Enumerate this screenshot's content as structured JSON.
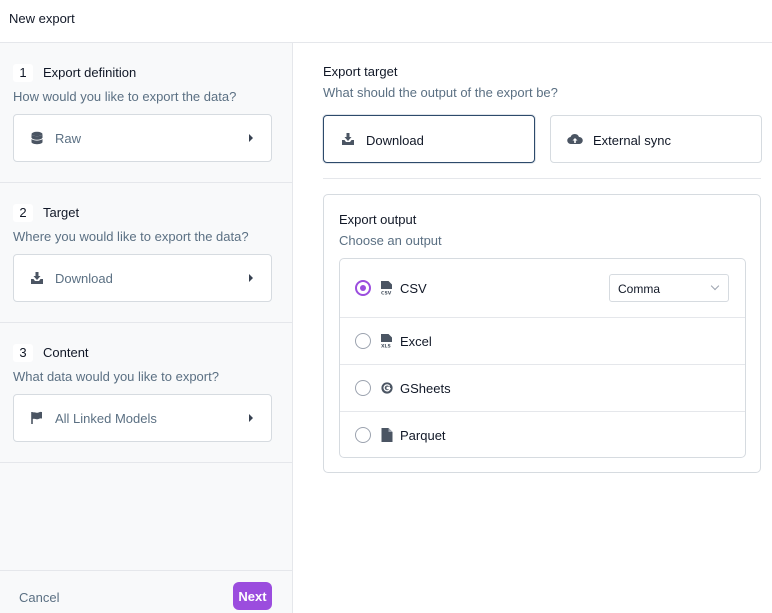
{
  "window": {
    "title": "New export"
  },
  "steps": [
    {
      "number": "1",
      "label": "Export definition",
      "question": "How would you like to export the data?",
      "value": "Raw",
      "icon": "database-icon"
    },
    {
      "number": "2",
      "label": "Target",
      "question": "Where you would like to export the data?",
      "value": "Download",
      "icon": "download-icon"
    },
    {
      "number": "3",
      "label": "Content",
      "question": "What data would you like to export?",
      "value": "All Linked Models",
      "icon": "flag-icon"
    }
  ],
  "footer": {
    "cancel_label": "Cancel",
    "next_label": "Next"
  },
  "target": {
    "heading": "Export target",
    "subheading": "What should the output of the export be?",
    "options": [
      {
        "label": "Download",
        "icon": "download-icon",
        "selected": true
      },
      {
        "label": "External sync",
        "icon": "cloud-upload-icon",
        "selected": false
      }
    ]
  },
  "output": {
    "heading": "Export output",
    "subheading": "Choose an output",
    "options": [
      {
        "label": "CSV",
        "icon": "csv-file-icon",
        "selected": true,
        "delimiter": "Comma"
      },
      {
        "label": "Excel",
        "icon": "xls-file-icon",
        "selected": false
      },
      {
        "label": "GSheets",
        "icon": "google-icon",
        "selected": false
      },
      {
        "label": "Parquet",
        "icon": "file-icon",
        "selected": false
      }
    ]
  },
  "colors": {
    "accent": "#9b4dde",
    "selected_border": "#2d4a6b",
    "muted_text": "#5b7083"
  }
}
